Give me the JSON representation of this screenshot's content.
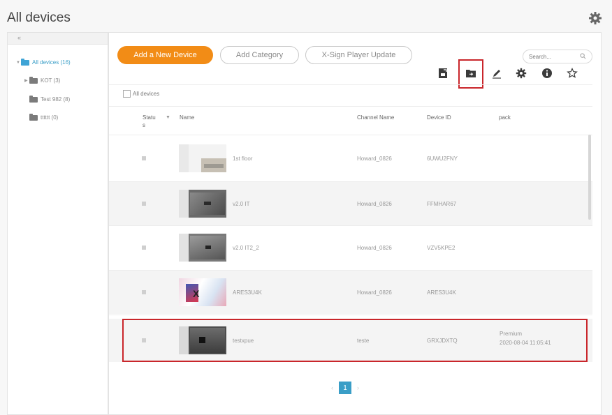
{
  "header": {
    "title": "All devices",
    "settings_icon": "gear-icon"
  },
  "sidebar": {
    "collapse_glyph": "«",
    "items": [
      {
        "label": "All devices (16)",
        "expanded": true,
        "icon": "folder-open-icon"
      },
      {
        "label": "KOT (3)",
        "expanded": false,
        "icon": "folder-icon"
      },
      {
        "label": "Test 982 (8)",
        "icon": "folder-icon"
      },
      {
        "label": "tttttt (0)",
        "icon": "folder-icon"
      }
    ]
  },
  "toolbar": {
    "add_device_label": "Add a New Device",
    "add_category_label": "Add Category",
    "xsign_update_label": "X-Sign Player Update",
    "search_placeholder": "Search...",
    "icons": [
      "export-icon",
      "move-to-folder-icon",
      "edit-icon",
      "settings-icon",
      "info-icon",
      "favorite-icon"
    ]
  },
  "select_all_label": "All devices",
  "table": {
    "columns": {
      "status": "Statu s",
      "name": "Name",
      "channel": "Channel Name",
      "device_id": "Device ID",
      "pack": "pack"
    },
    "rows": [
      {
        "name": "1st floor",
        "channel": "Howard_0826",
        "device_id": "6UWU2FNY",
        "pack": "",
        "pack_date": ""
      },
      {
        "name": "v2.0 IT",
        "channel": "Howard_0826",
        "device_id": "FFMHAR67",
        "pack": "",
        "pack_date": ""
      },
      {
        "name": "v2.0 IT2_2",
        "channel": "Howard_0826",
        "device_id": "VZV5KPE2",
        "pack": "",
        "pack_date": ""
      },
      {
        "name": "ARES3U4K",
        "channel": "Howard_0826",
        "device_id": "ARES3U4K",
        "pack": "",
        "pack_date": ""
      },
      {
        "name": "testxpue",
        "channel": "teste",
        "device_id": "GRXJDXTQ",
        "pack": "Premium",
        "pack_date": "2020-08-04 11:05:41"
      }
    ]
  },
  "pagination": {
    "prev": "‹",
    "current": "1",
    "next": "›"
  },
  "colors": {
    "primary_button": "#f28c16",
    "highlight": "#c9262b",
    "page_active": "#3a9ec7",
    "folder_open": "#3fa4d6"
  }
}
